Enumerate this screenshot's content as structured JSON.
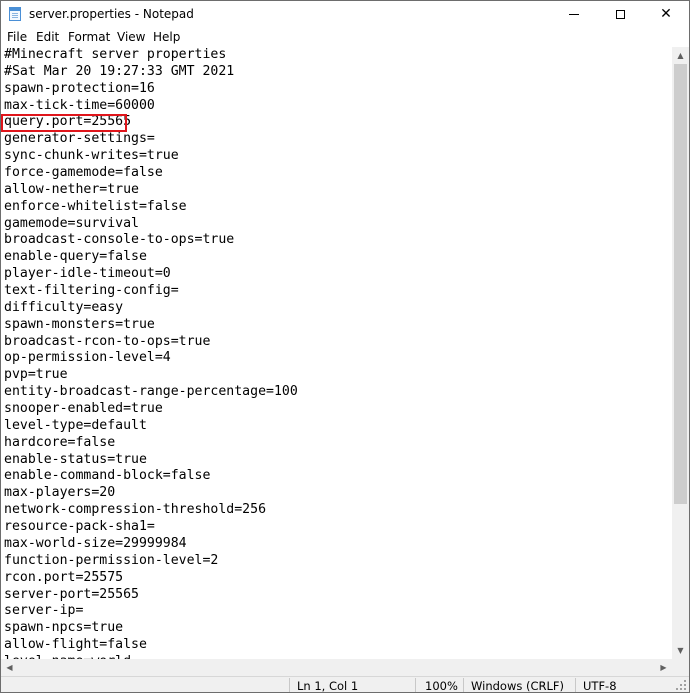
{
  "window": {
    "title": "server.properties - Notepad",
    "close_symbol": "✕"
  },
  "menu": [
    "File",
    "Edit",
    "Format",
    "View",
    "Help"
  ],
  "editor": {
    "highlighted_line": "query.port=25565",
    "highlight_color": "#e0151b",
    "lines": [
      "#Minecraft server properties",
      "#Sat Mar 20 19:27:33 GMT 2021",
      "spawn-protection=16",
      "max-tick-time=60000",
      "query.port=25565",
      "generator-settings=",
      "sync-chunk-writes=true",
      "force-gamemode=false",
      "allow-nether=true",
      "enforce-whitelist=false",
      "gamemode=survival",
      "broadcast-console-to-ops=true",
      "enable-query=false",
      "player-idle-timeout=0",
      "text-filtering-config=",
      "difficulty=easy",
      "spawn-monsters=true",
      "broadcast-rcon-to-ops=true",
      "op-permission-level=4",
      "pvp=true",
      "entity-broadcast-range-percentage=100",
      "snooper-enabled=true",
      "level-type=default",
      "hardcore=false",
      "enable-status=true",
      "enable-command-block=false",
      "max-players=20",
      "network-compression-threshold=256",
      "resource-pack-sha1=",
      "max-world-size=29999984",
      "function-permission-level=2",
      "rcon.port=25575",
      "server-port=25565",
      "server-ip=",
      "spawn-npcs=true",
      "allow-flight=false",
      "level-name=world"
    ]
  },
  "status": {
    "position": "Ln 1, Col 1",
    "zoom": "100%",
    "line_ending": "Windows (CRLF)",
    "encoding": "UTF-8"
  }
}
